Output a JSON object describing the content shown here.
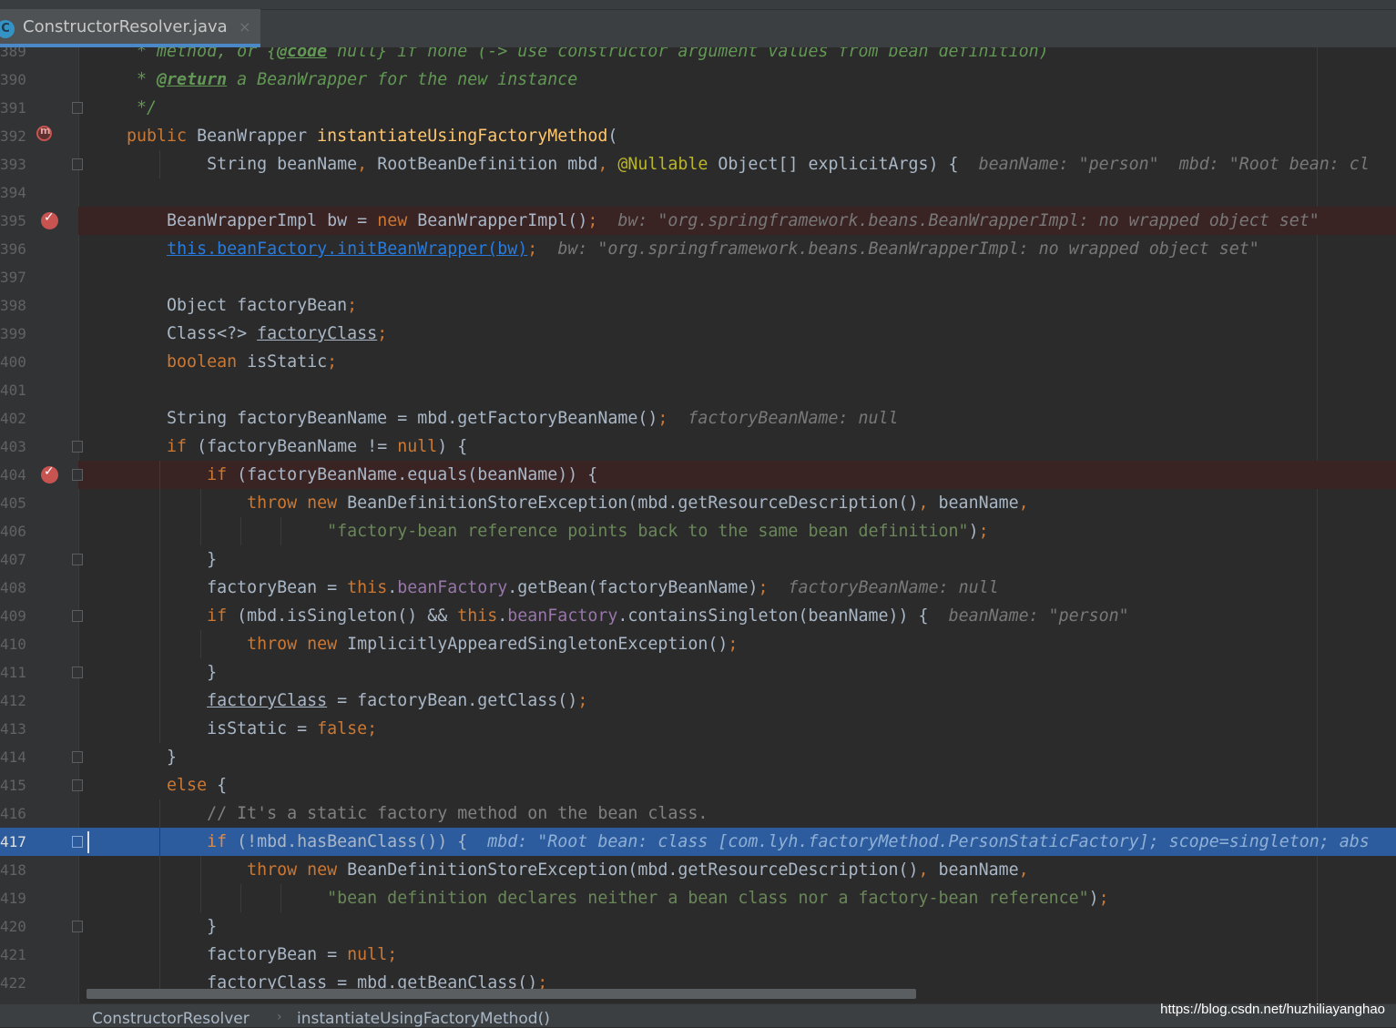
{
  "tab": {
    "icon": "C",
    "filename": "ConstructorResolver.java",
    "close": "×"
  },
  "code_lines": [
    {
      "num": "389",
      "segs": [
        [
          "cmt",
          "     * method, or {"
        ],
        [
          "cmtb",
          "@code"
        ],
        [
          "cmt",
          " null} if none (-> use constructor argument values from bean definition)"
        ]
      ]
    },
    {
      "num": "390",
      "segs": [
        [
          "cmt",
          "     * "
        ],
        [
          "cmtb",
          "@return"
        ],
        [
          "cmt",
          " a BeanWrapper for the new instance"
        ]
      ]
    },
    {
      "num": "391",
      "fold": true,
      "segs": [
        [
          "cmt",
          "     */"
        ]
      ]
    },
    {
      "num": "392",
      "override": true,
      "segs": [
        [
          "kw",
          "    public "
        ],
        [
          "",
          "BeanWrapper "
        ],
        [
          "fn",
          "instantiateUsingFactoryMethod"
        ],
        [
          "",
          "("
        ]
      ]
    },
    {
      "num": "393",
      "fold": true,
      "segs": [
        [
          "",
          "            String beanName"
        ],
        [
          "kw",
          ", "
        ],
        [
          "",
          "RootBeanDefinition mbd"
        ],
        [
          "kw",
          ", "
        ],
        [
          "ann",
          "@Nullable"
        ],
        [
          "",
          " Object[] explicitArgs) {  "
        ],
        [
          "hint",
          "beanName: \"person\"  mbd: \"Root bean: cl"
        ]
      ]
    },
    {
      "num": "394",
      "segs": []
    },
    {
      "num": "395",
      "bp": true,
      "segs": [
        [
          "",
          "        BeanWrapperImpl bw = "
        ],
        [
          "kw",
          "new "
        ],
        [
          "",
          "BeanWrapperImpl()"
        ],
        [
          "kw",
          ";  "
        ],
        [
          "hint",
          "bw: \"org.springframework.beans.BeanWrapperImpl: no wrapped object set\""
        ]
      ]
    },
    {
      "num": "396",
      "segs": [
        [
          "",
          "        "
        ],
        [
          "lnk",
          "this.beanFactory.initBeanWrapper(bw)"
        ],
        [
          "kw",
          ";  "
        ],
        [
          "hint",
          "bw: \"org.springframework.beans.BeanWrapperImpl: no wrapped object set\""
        ]
      ]
    },
    {
      "num": "397",
      "segs": []
    },
    {
      "num": "398",
      "segs": [
        [
          "",
          "        Object factoryBean"
        ],
        [
          "kw",
          ";"
        ]
      ]
    },
    {
      "num": "399",
      "segs": [
        [
          "",
          "        Class<?> "
        ],
        [
          "ul",
          "factoryClass"
        ],
        [
          "kw",
          ";"
        ]
      ]
    },
    {
      "num": "400",
      "segs": [
        [
          "kw",
          "        boolean "
        ],
        [
          "",
          "isStatic"
        ],
        [
          "kw",
          ";"
        ]
      ]
    },
    {
      "num": "401",
      "segs": []
    },
    {
      "num": "402",
      "segs": [
        [
          "",
          "        String factoryBeanName = mbd.getFactoryBeanName()"
        ],
        [
          "kw",
          ";  "
        ],
        [
          "hint",
          "factoryBeanName: null"
        ]
      ]
    },
    {
      "num": "403",
      "fold": true,
      "segs": [
        [
          "kw",
          "        if "
        ],
        [
          "",
          "(factoryBeanName != "
        ],
        [
          "kw",
          "null"
        ],
        [
          "",
          ") {"
        ]
      ]
    },
    {
      "num": "404",
      "bp": true,
      "fold": true,
      "segs": [
        [
          "kw",
          "            if "
        ],
        [
          "",
          "(factoryBeanName.equals(beanName)) {"
        ]
      ]
    },
    {
      "num": "405",
      "segs": [
        [
          "kw",
          "                throw new "
        ],
        [
          "",
          "BeanDefinitionStoreException(mbd.getResourceDescription()"
        ],
        [
          "kw",
          ", "
        ],
        [
          "",
          "beanName"
        ],
        [
          "kw",
          ","
        ]
      ]
    },
    {
      "num": "406",
      "segs": [
        [
          "str",
          "                        \"factory-bean reference points back to the same bean definition\""
        ],
        [
          "",
          ")"
        ],
        [
          "kw",
          ";"
        ]
      ]
    },
    {
      "num": "407",
      "fold": true,
      "segs": [
        [
          "",
          "            }"
        ]
      ]
    },
    {
      "num": "408",
      "segs": [
        [
          "",
          "            factoryBean = "
        ],
        [
          "kw",
          "this"
        ],
        [
          "",
          "."
        ],
        [
          "fld",
          "beanFactory"
        ],
        [
          "",
          ".getBean(factoryBeanName)"
        ],
        [
          "kw",
          ";  "
        ],
        [
          "hint",
          "factoryBeanName: null"
        ]
      ]
    },
    {
      "num": "409",
      "fold": true,
      "segs": [
        [
          "kw",
          "            if "
        ],
        [
          "",
          "(mbd.isSingleton() && "
        ],
        [
          "kw",
          "this"
        ],
        [
          "",
          "."
        ],
        [
          "fld",
          "beanFactory"
        ],
        [
          "",
          ".containsSingleton(beanName)) {  "
        ],
        [
          "hint",
          "beanName: \"person\""
        ]
      ]
    },
    {
      "num": "410",
      "segs": [
        [
          "kw",
          "                throw new "
        ],
        [
          "",
          "ImplicitlyAppearedSingletonException()"
        ],
        [
          "kw",
          ";"
        ]
      ]
    },
    {
      "num": "411",
      "fold": true,
      "segs": [
        [
          "",
          "            }"
        ]
      ]
    },
    {
      "num": "412",
      "segs": [
        [
          "",
          "            "
        ],
        [
          "ul",
          "factoryClass"
        ],
        [
          "",
          " = factoryBean.getClass()"
        ],
        [
          "kw",
          ";"
        ]
      ]
    },
    {
      "num": "413",
      "segs": [
        [
          "",
          "            isStatic = "
        ],
        [
          "kw",
          "false;"
        ]
      ]
    },
    {
      "num": "414",
      "fold": true,
      "segs": [
        [
          "",
          "        }"
        ]
      ]
    },
    {
      "num": "415",
      "fold": true,
      "segs": [
        [
          "kw",
          "        else "
        ],
        [
          "",
          "{"
        ]
      ]
    },
    {
      "num": "416",
      "segs": [
        [
          "lc",
          "            // It's a static factory method on the bean class."
        ]
      ]
    },
    {
      "num": "417",
      "current": true,
      "fold": true,
      "segs": [
        [
          "kw",
          "            if "
        ],
        [
          "",
          "(!mbd.hasBeanClass()) {  "
        ],
        [
          "hint",
          "mbd: \"Root bean: class [com.lyh.factoryMethod.PersonStaticFactory]; scope=singleton; abs"
        ]
      ]
    },
    {
      "num": "418",
      "segs": [
        [
          "kw",
          "                throw new "
        ],
        [
          "",
          "BeanDefinitionStoreException(mbd.getResourceDescription()"
        ],
        [
          "kw",
          ", "
        ],
        [
          "",
          "beanName"
        ],
        [
          "kw",
          ","
        ]
      ]
    },
    {
      "num": "419",
      "segs": [
        [
          "str",
          "                        \"bean definition declares neither a bean class nor a factory-bean reference\""
        ],
        [
          "",
          ")"
        ],
        [
          "kw",
          ";"
        ]
      ]
    },
    {
      "num": "420",
      "fold": true,
      "segs": [
        [
          "",
          "            }"
        ]
      ]
    },
    {
      "num": "421",
      "segs": [
        [
          "",
          "            factoryBean = "
        ],
        [
          "kw",
          "null;"
        ]
      ]
    },
    {
      "num": "422",
      "segs": [
        [
          "",
          "            "
        ],
        [
          "ul",
          "factoryClass"
        ],
        [
          "",
          " = mbd.getBeanClass()"
        ],
        [
          "kw",
          ";"
        ]
      ]
    }
  ],
  "breadcrumb": {
    "class_name": "ConstructorResolver",
    "separator": "›",
    "method_name": "instantiateUsingFactoryMethod()"
  },
  "watermark": "https://blog.csdn.net/huzhiliayanghao",
  "colors": {
    "keyword": "#cc7832",
    "method": "#ffc66d",
    "string": "#6a8759",
    "comment": "#629755",
    "field": "#9876aa",
    "annotation": "#bbb529",
    "current_line": "#2d5c9e",
    "breakpoint_line": "#3a2323"
  }
}
